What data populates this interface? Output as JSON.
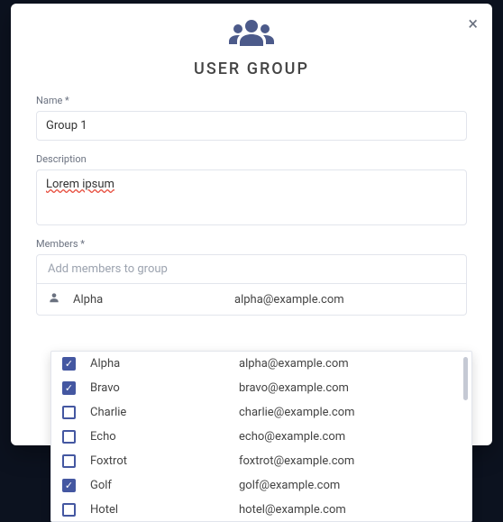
{
  "modal": {
    "title": "USER GROUP",
    "close_label": "×"
  },
  "fields": {
    "name": {
      "label": "Name *",
      "value": "Group 1"
    },
    "description": {
      "label": "Description",
      "value": "Lorem ipsum"
    },
    "members": {
      "label": "Members *",
      "placeholder": "Add members to group"
    }
  },
  "selected": [
    {
      "name": "Alpha",
      "email": "alpha@example.com"
    }
  ],
  "options": [
    {
      "name": "Alpha",
      "email": "alpha@example.com",
      "checked": true
    },
    {
      "name": "Bravo",
      "email": "bravo@example.com",
      "checked": true
    },
    {
      "name": "Charlie",
      "email": "charlie@example.com",
      "checked": false
    },
    {
      "name": "Echo",
      "email": "echo@example.com",
      "checked": false
    },
    {
      "name": "Foxtrot",
      "email": "foxtrot@example.com",
      "checked": false
    },
    {
      "name": "Golf",
      "email": "golf@example.com",
      "checked": true
    },
    {
      "name": "Hotel",
      "email": "hotel@example.com",
      "checked": false
    }
  ]
}
